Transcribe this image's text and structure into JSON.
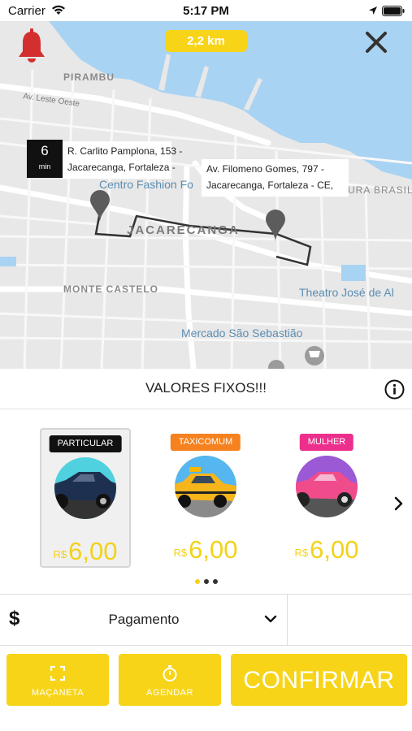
{
  "status_bar": {
    "carrier": "Carrier",
    "time": "5:17 PM"
  },
  "map": {
    "distance": "2,2 km",
    "labels": {
      "pirambu": "PIRAMBU",
      "av_leste_oeste": "Av. Leste Oeste",
      "centro_fashion": "Centro Fashion Fo",
      "jacarecanga": "JACARECANGA",
      "monte_castelo": "MONTE CASTELO",
      "theatro": "Theatro José de Al",
      "mercado": "Mercado São Sebastião",
      "brasil": "URA BRASIL"
    },
    "eta": {
      "value": "6",
      "unit": "min"
    },
    "origin_address": [
      "R. Carlito Pamplona, 153 -",
      "Jacarecanga, Fortaleza -"
    ],
    "destination_address": [
      "Av. Filomeno Gomes, 797 -",
      "Jacarecanga, Fortaleza - CE,"
    ]
  },
  "fixed_values": {
    "title": "VALORES FIXOS!!!"
  },
  "vehicle_options": [
    {
      "tag": "PARTICULAR",
      "tag_color": "#111111",
      "currency": "R$",
      "price": "6,00",
      "selected": true
    },
    {
      "tag": "TAXICOMUM",
      "tag_color": "#f5821f",
      "currency": "R$",
      "price": "6,00",
      "selected": false
    },
    {
      "tag": "MULHER",
      "tag_color": "#ec2f8c",
      "currency": "R$",
      "price": "6,00",
      "selected": false
    }
  ],
  "carousel": {
    "page_count": 3,
    "active_page": 1
  },
  "payment": {
    "symbol": "$",
    "label": "Pagamento"
  },
  "actions": {
    "macaneta": "MAÇANETA",
    "agendar": "AGENDAR",
    "confirmar": "CONFIRMAR"
  },
  "colors": {
    "accent": "#f7d417",
    "price": "#f2d21a",
    "water": "#a9d3f2",
    "bell": "#d32f2f"
  }
}
